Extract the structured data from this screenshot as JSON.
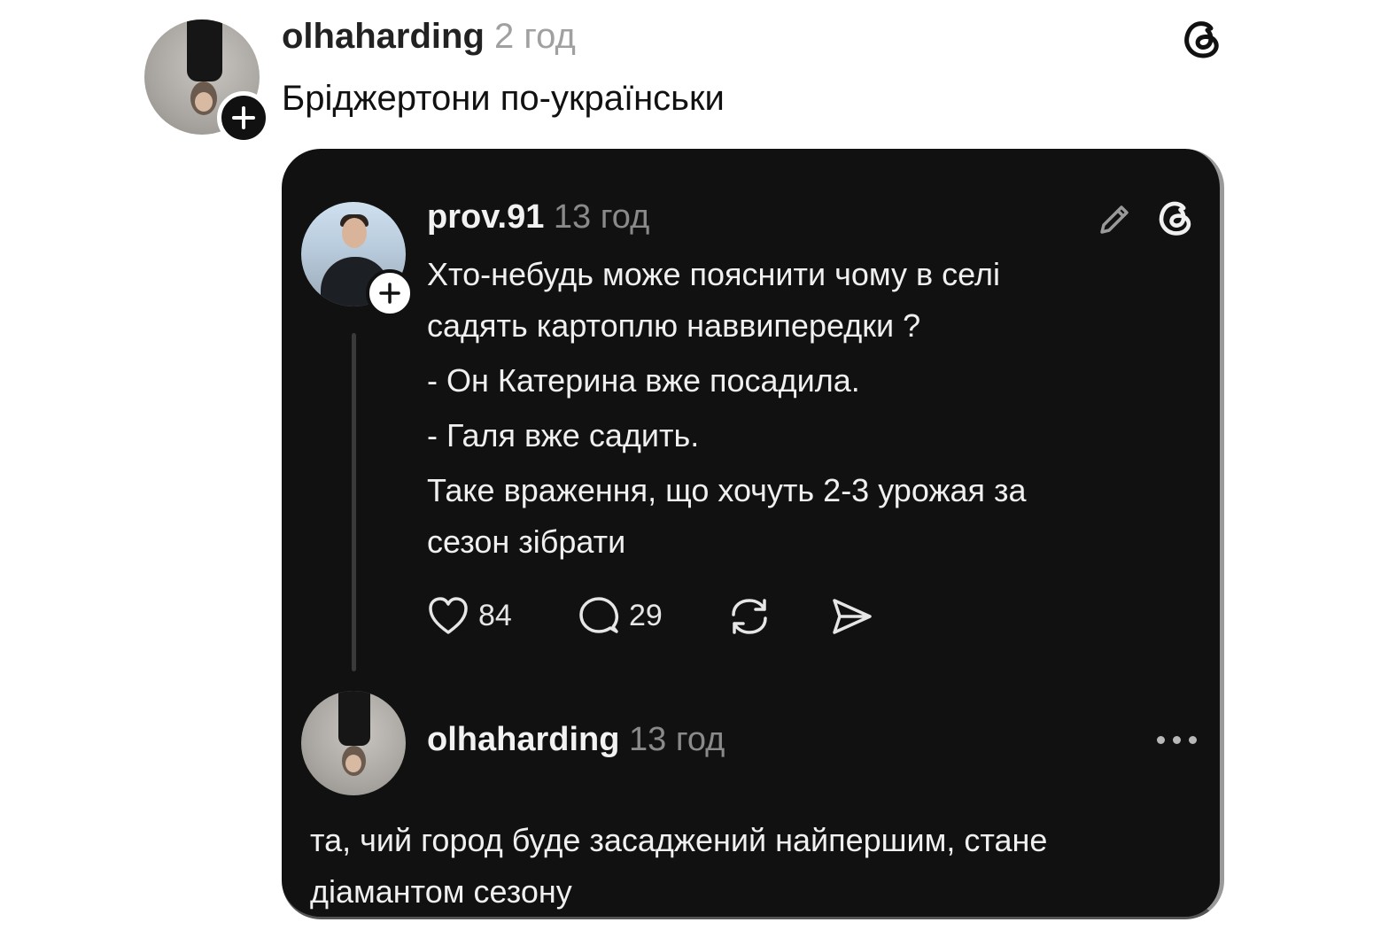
{
  "post": {
    "username": "olhaharding",
    "time": "2 год",
    "text": "Бріджертони по-українськи",
    "icons": {
      "avatar": "avatar-photo",
      "follow": "plus-icon",
      "app": "threads-logo-icon"
    }
  },
  "quoted": {
    "username": "prov.91",
    "time": "13 год",
    "lines": [
      "Хто-небудь може пояснити чому в селі",
      "садять картоплю наввипередки ?",
      "- Он Катерина вже посадила.",
      "- Галя вже садить.",
      "Таке враження, що хочуть 2-3 урожая за",
      "сезон зібрати"
    ],
    "likes": "84",
    "comments": "29",
    "icons": {
      "edit": "pencil-icon",
      "app": "threads-logo-icon",
      "like": "heart-icon",
      "comment": "comment-bubble-icon",
      "repost": "repost-icon",
      "share": "send-icon"
    }
  },
  "reply": {
    "username": "olhaharding",
    "time": "13 год",
    "lines": [
      "та, чий город буде засаджений найпершим, стане",
      "діамантом сезону"
    ],
    "icons": {
      "more": "more-dots-icon"
    }
  },
  "colors": {
    "card_bg": "#111111",
    "page_bg": "#ffffff",
    "text_dark": "#222222",
    "muted": "#a0a0a0"
  }
}
